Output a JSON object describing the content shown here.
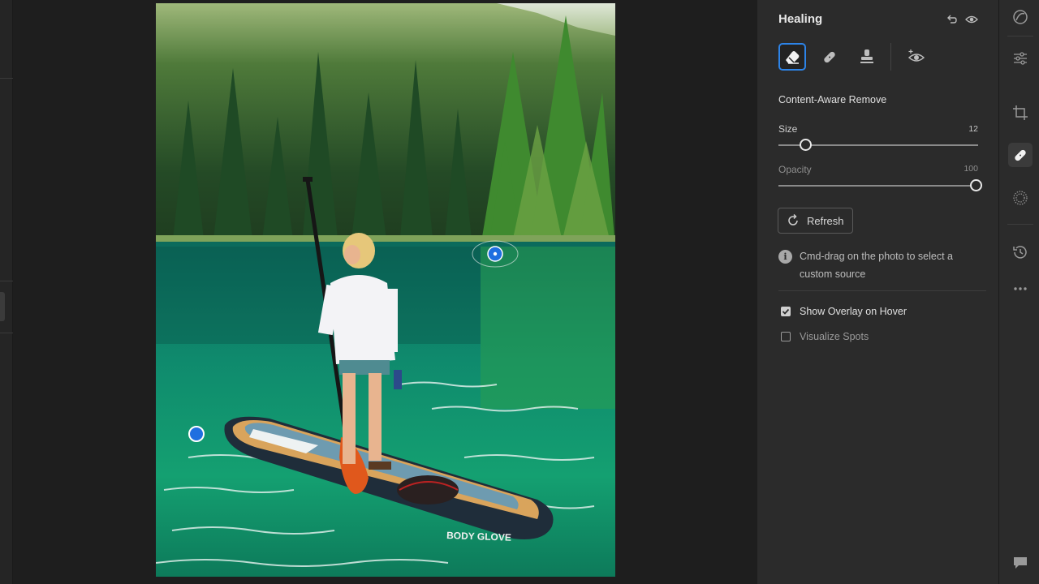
{
  "panel": {
    "title": "Healing",
    "mode_label": "Content-Aware Remove",
    "size": {
      "label": "Size",
      "value": "12",
      "level": 0.12
    },
    "opacity": {
      "label": "Opacity",
      "value": "100",
      "level": 1.0
    },
    "refresh_label": "Refresh",
    "info_text": "Cmd-drag on the photo to select a custom source",
    "show_overlay": {
      "label": "Show Overlay on Hover",
      "checked": true
    },
    "visualize_spots": {
      "label": "Visualize Spots",
      "checked": false
    },
    "tools": [
      "content-aware-remove-tool",
      "heal-tool",
      "clone-tool",
      "red-eye-tool"
    ]
  },
  "photo": {
    "board_brand": "BODY GLOVE"
  },
  "toolbar": {
    "items": [
      "profile-icon",
      "edit-sliders-icon",
      "crop-icon",
      "healing-icon",
      "masking-icon",
      "history-icon",
      "more-icon",
      "comment-icon"
    ],
    "active": "healing-icon"
  },
  "colors": {
    "accent": "#2d84e8",
    "panel_bg": "#2b2b2b",
    "canvas_bg": "#1e1e1e"
  }
}
